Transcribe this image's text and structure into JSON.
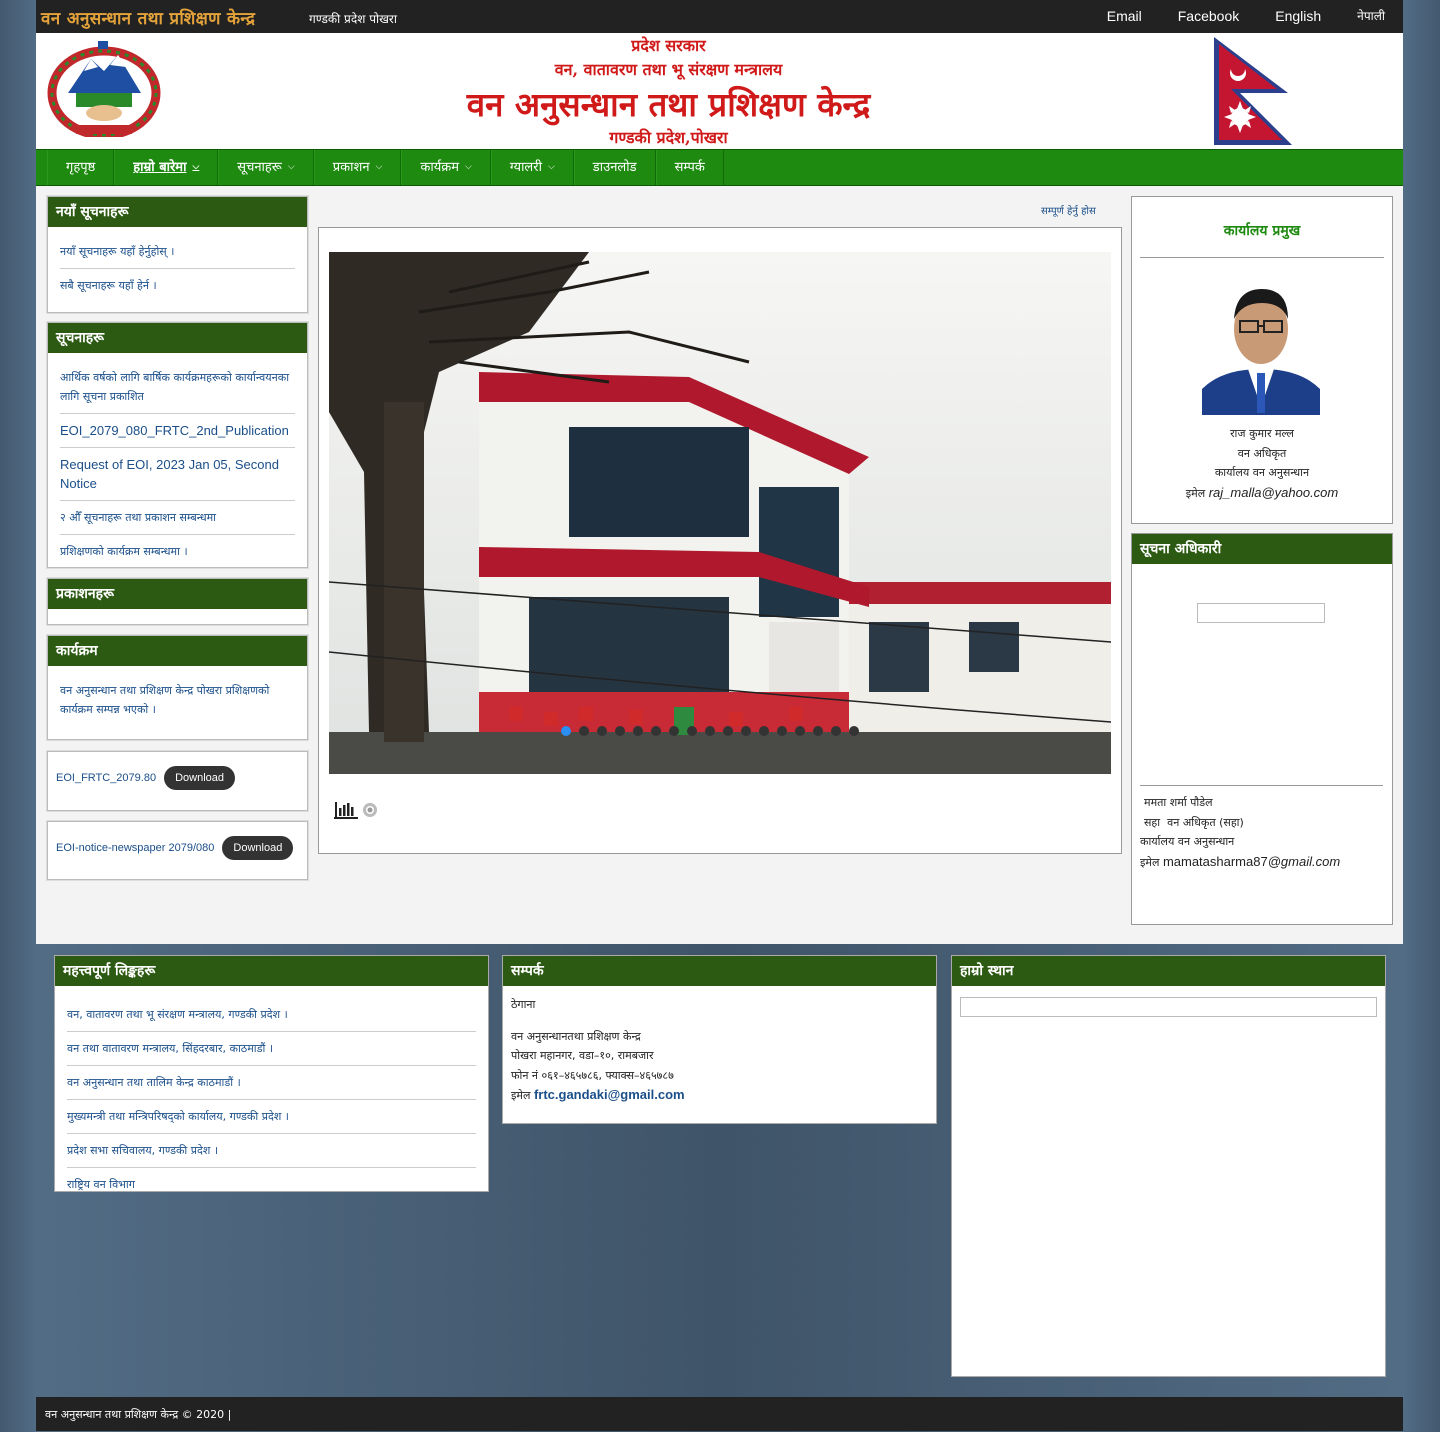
{
  "topbar": {
    "title": "वन अनुसन्धान तथा प्रशिक्षण केन्द्र",
    "subtitle": "गण्डकी प्रदेश पोखरा",
    "links": [
      "Email",
      "Facebook",
      "English",
      "नेपाली"
    ]
  },
  "header": {
    "line1": "प्रदेश सरकार",
    "line2": "वन, वातावरण तथा भू संरक्षण मन्त्रालय",
    "line3": "वन अनुसन्धान तथा प्रशिक्षण केन्द्र",
    "line4": "गण्डकी प्रदेश,पोखरा"
  },
  "nav": {
    "items": [
      {
        "label": "गृहपृष्ठ",
        "caret": false
      },
      {
        "label": "हाम्रो बारेमा",
        "caret": true
      },
      {
        "label": "सूचनाहरू",
        "caret": true
      },
      {
        "label": "प्रकाशन",
        "caret": true
      },
      {
        "label": "कार्यक्रम",
        "caret": true
      },
      {
        "label": "ग्यालरी",
        "caret": true
      },
      {
        "label": "डाउनलोड",
        "caret": false
      },
      {
        "label": "सम्पर्क",
        "caret": false
      }
    ]
  },
  "left": {
    "w1": {
      "title": "नयाँ सूचनाहरू",
      "items": [
        "नयाँ सूचनाहरू यहाँ हेर्नुहोस् ।",
        "सबै सूचनाहरू यहाँ हेर्न ।"
      ]
    },
    "w2": {
      "title": "सूचनाहरू",
      "items": [
        {
          "text": "आर्थिक वर्षको लागि बार्षिक कार्यक्रमहरूको कार्यान्वयनका लागि सूचना प्रकाशित",
          "en": false
        },
        {
          "text": "EOI_2079_080_FRTC_2nd_Publication",
          "en": true
        },
        {
          "text": "Request of EOI, 2023 Jan 05, Second Notice",
          "en": true
        },
        {
          "text": "२ औँ सूचनाहरू तथा प्रकाशन सम्बन्धमा",
          "en": false
        },
        {
          "text": "प्रशिक्षणको कार्यक्रम सम्बन्धमा ।",
          "en": false
        }
      ]
    },
    "w3": {
      "title": "प्रकाशनहरू"
    },
    "w4": {
      "title": "कार्यक्रम",
      "items": [
        "वन अनुसन्धान तथा प्रशिक्षण केन्द्र पोखरा प्रशिक्षणको कार्यक्रम सम्पन्न भएको ।"
      ]
    },
    "dl1": {
      "name": "EOI_FRTC_2079.80",
      "button": "Download"
    },
    "dl2": {
      "name": "EOI-notice-newspaper 2079/080",
      "button": "Download"
    }
  },
  "center": {
    "more_link": "सम्पूर्ण हेर्नु होस",
    "slide_count": 17,
    "active_slide": 0
  },
  "right": {
    "person": {
      "title": "कार्यालय प्रमुख",
      "name": "राज कुमार मल्ल",
      "post": "वन अधिकृत",
      "office": "कार्यालय वन अनुसन्धान",
      "email_label": "इमेल",
      "email": "raj_malla@yahoo.com"
    },
    "info": {
      "title": "सूचना अधिकारी",
      "name": "ममता शर्मा पौडेल",
      "post_prefix": "सहा",
      "post": "वन अधिकृत (सहा)",
      "office": "कार्यालय वन अनुसन्धान",
      "email_label": "इमेल",
      "email": "mamatasharma87",
      "email_domain": "@gmail.com"
    }
  },
  "footer": {
    "links": {
      "title": "महत्त्वपूर्ण लिङ्कहरू",
      "items": [
        "वन, वातावरण तथा भू संरक्षण मन्त्रालय, गण्डकी प्रदेश ।",
        "वन तथा वातावरण मन्त्रालय, सिंहदरबार, काठमाडौं ।",
        "वन अनुसन्धान तथा तालिम केन्द्र काठमाडौं ।",
        "मुख्यमन्त्री तथा मन्त्रिपरिषद्को कार्यालय, गण्डकी प्रदेश ।",
        "प्रदेश सभा सचिवालय, गण्डकी प्रदेश ।",
        "राष्ट्रिय वन विभाग"
      ]
    },
    "contact": {
      "title": "सम्पर्क",
      "heading": "ठेगाना",
      "lines": [
        "वन अनुसन्धानतथा प्रशिक्षण केन्द्र",
        "पोखरा महानगर, वडा–१०, रामबजार",
        "फोन नं ०६१–४६५७८६, फ्याक्स–४६५७८७"
      ],
      "email_label": "इमेल",
      "email": "frtc.gandaki@gmail.com"
    },
    "map": {
      "title": "हाम्रो स्थान"
    }
  },
  "copyright": "वन अनुसन्धान तथा प्रशिक्षण केन्द्र © 2020 |"
}
